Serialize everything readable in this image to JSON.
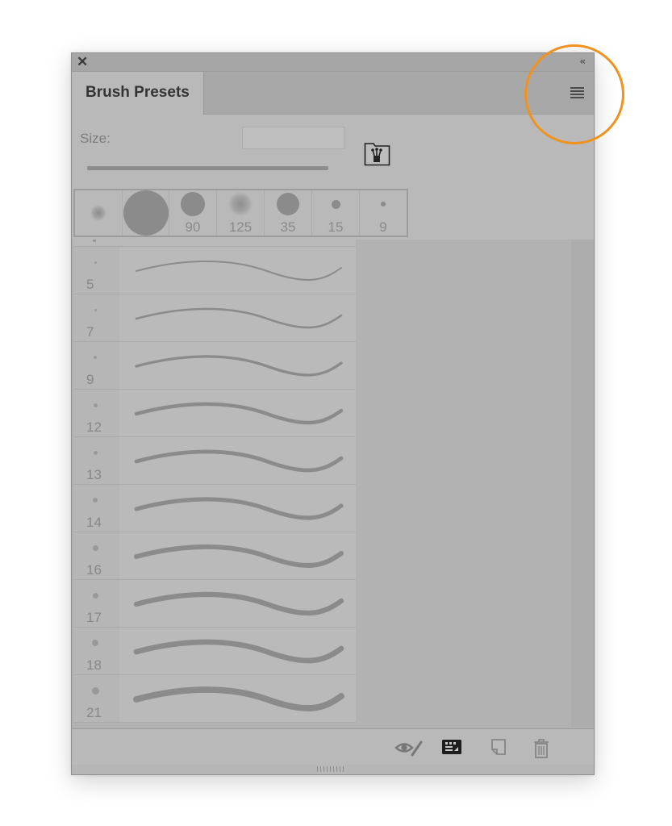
{
  "panel": {
    "title": "Brush Presets",
    "close_glyph": "✕",
    "collapse_glyph": "‹‹",
    "icons": {
      "close": "close-icon",
      "collapse": "collapse-panel-icon",
      "menu": "hamburger-menu-icon",
      "brush_folder": "brush-folder-icon"
    }
  },
  "size": {
    "label": "Size:",
    "value": ""
  },
  "recent_brushes": [
    {
      "label": "",
      "style": "soft"
    },
    {
      "label": "",
      "style": "hard-large"
    },
    {
      "label": "90",
      "style": "hard"
    },
    {
      "label": "125",
      "style": "soft"
    },
    {
      "label": "35",
      "style": "hard"
    },
    {
      "label": "15",
      "style": "hard"
    },
    {
      "label": "9",
      "style": "hard"
    }
  ],
  "brush_presets": [
    {
      "size": "5"
    },
    {
      "size": "7"
    },
    {
      "size": "9"
    },
    {
      "size": "12"
    },
    {
      "size": "13"
    },
    {
      "size": "14"
    },
    {
      "size": "16"
    },
    {
      "size": "17"
    },
    {
      "size": "18"
    },
    {
      "size": "21"
    }
  ],
  "footer": {
    "buttons": [
      {
        "name": "toggle-brush-visibility",
        "icon": "eye-brush-icon"
      },
      {
        "name": "brush-panel",
        "icon": "brush-settings-icon"
      },
      {
        "name": "new-preset",
        "icon": "new-page-icon"
      },
      {
        "name": "delete-preset",
        "icon": "trash-icon"
      }
    ]
  },
  "colors": {
    "highlight": "#f0921e",
    "panel_bg": "#b9b9b9",
    "stroke": "#8b8b8b"
  }
}
